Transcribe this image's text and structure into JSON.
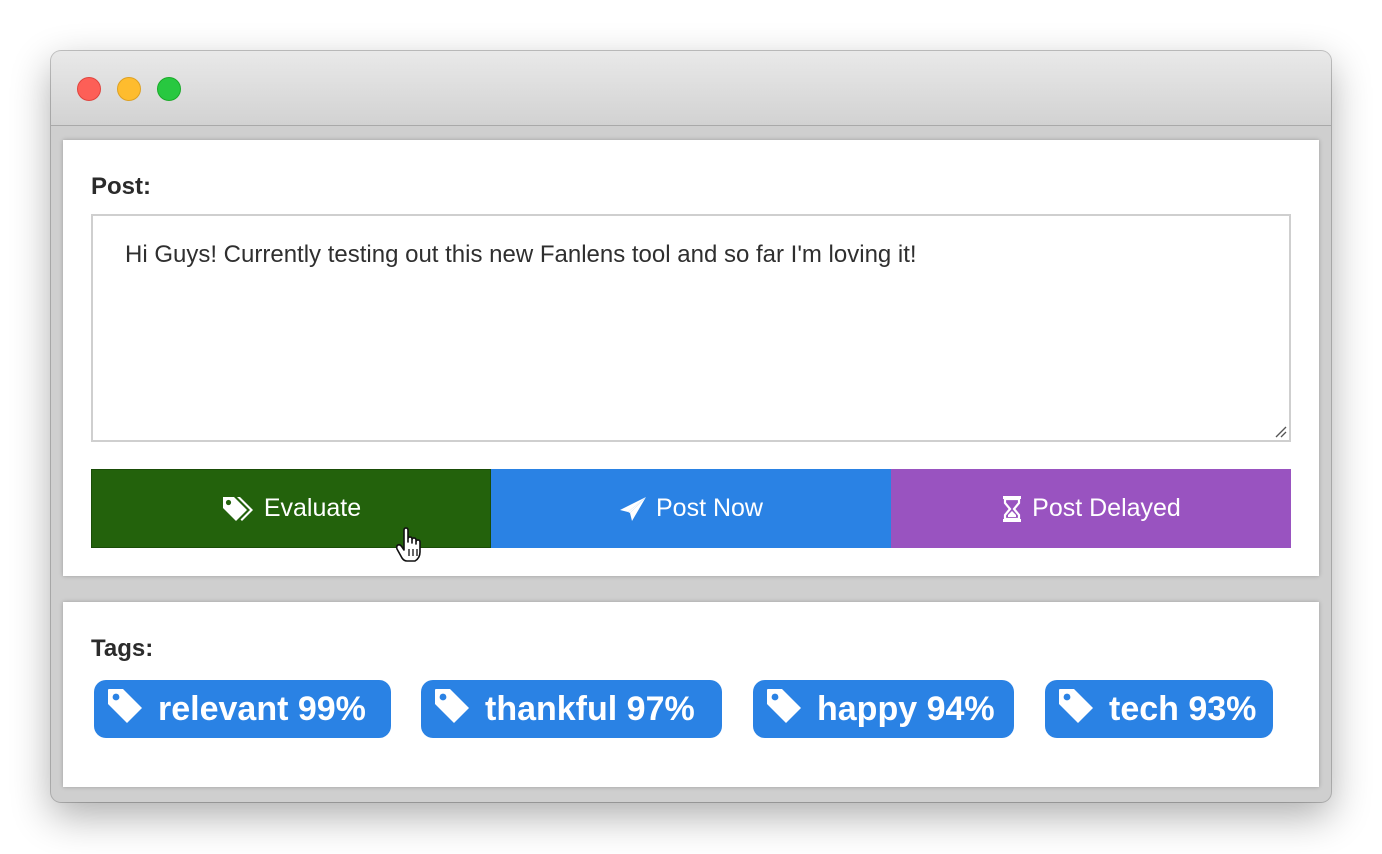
{
  "window": {
    "controls": [
      "close",
      "minimize",
      "maximize"
    ],
    "colors": {
      "close": "#fd5f57",
      "minimize": "#febc2e",
      "maximize": "#28c840"
    }
  },
  "post": {
    "label": "Post:",
    "text": "Hi Guys! Currently testing out this new Fanlens tool and so far I'm loving it!"
  },
  "actions": {
    "evaluate": {
      "label": "Evaluate",
      "icon": "tags-icon",
      "color": "#23620c"
    },
    "post_now": {
      "label": "Post Now",
      "icon": "paper-plane-icon",
      "color": "#2a82e4"
    },
    "post_delayed": {
      "label": "Post Delayed",
      "icon": "hourglass-icon",
      "color": "#9953c0"
    }
  },
  "tags": {
    "label": "Tags:",
    "items": [
      {
        "label": "relevant 99%"
      },
      {
        "label": "thankful 97%"
      },
      {
        "label": "happy 94%"
      },
      {
        "label": "tech 93%"
      }
    ],
    "color": "#2a82e4"
  }
}
